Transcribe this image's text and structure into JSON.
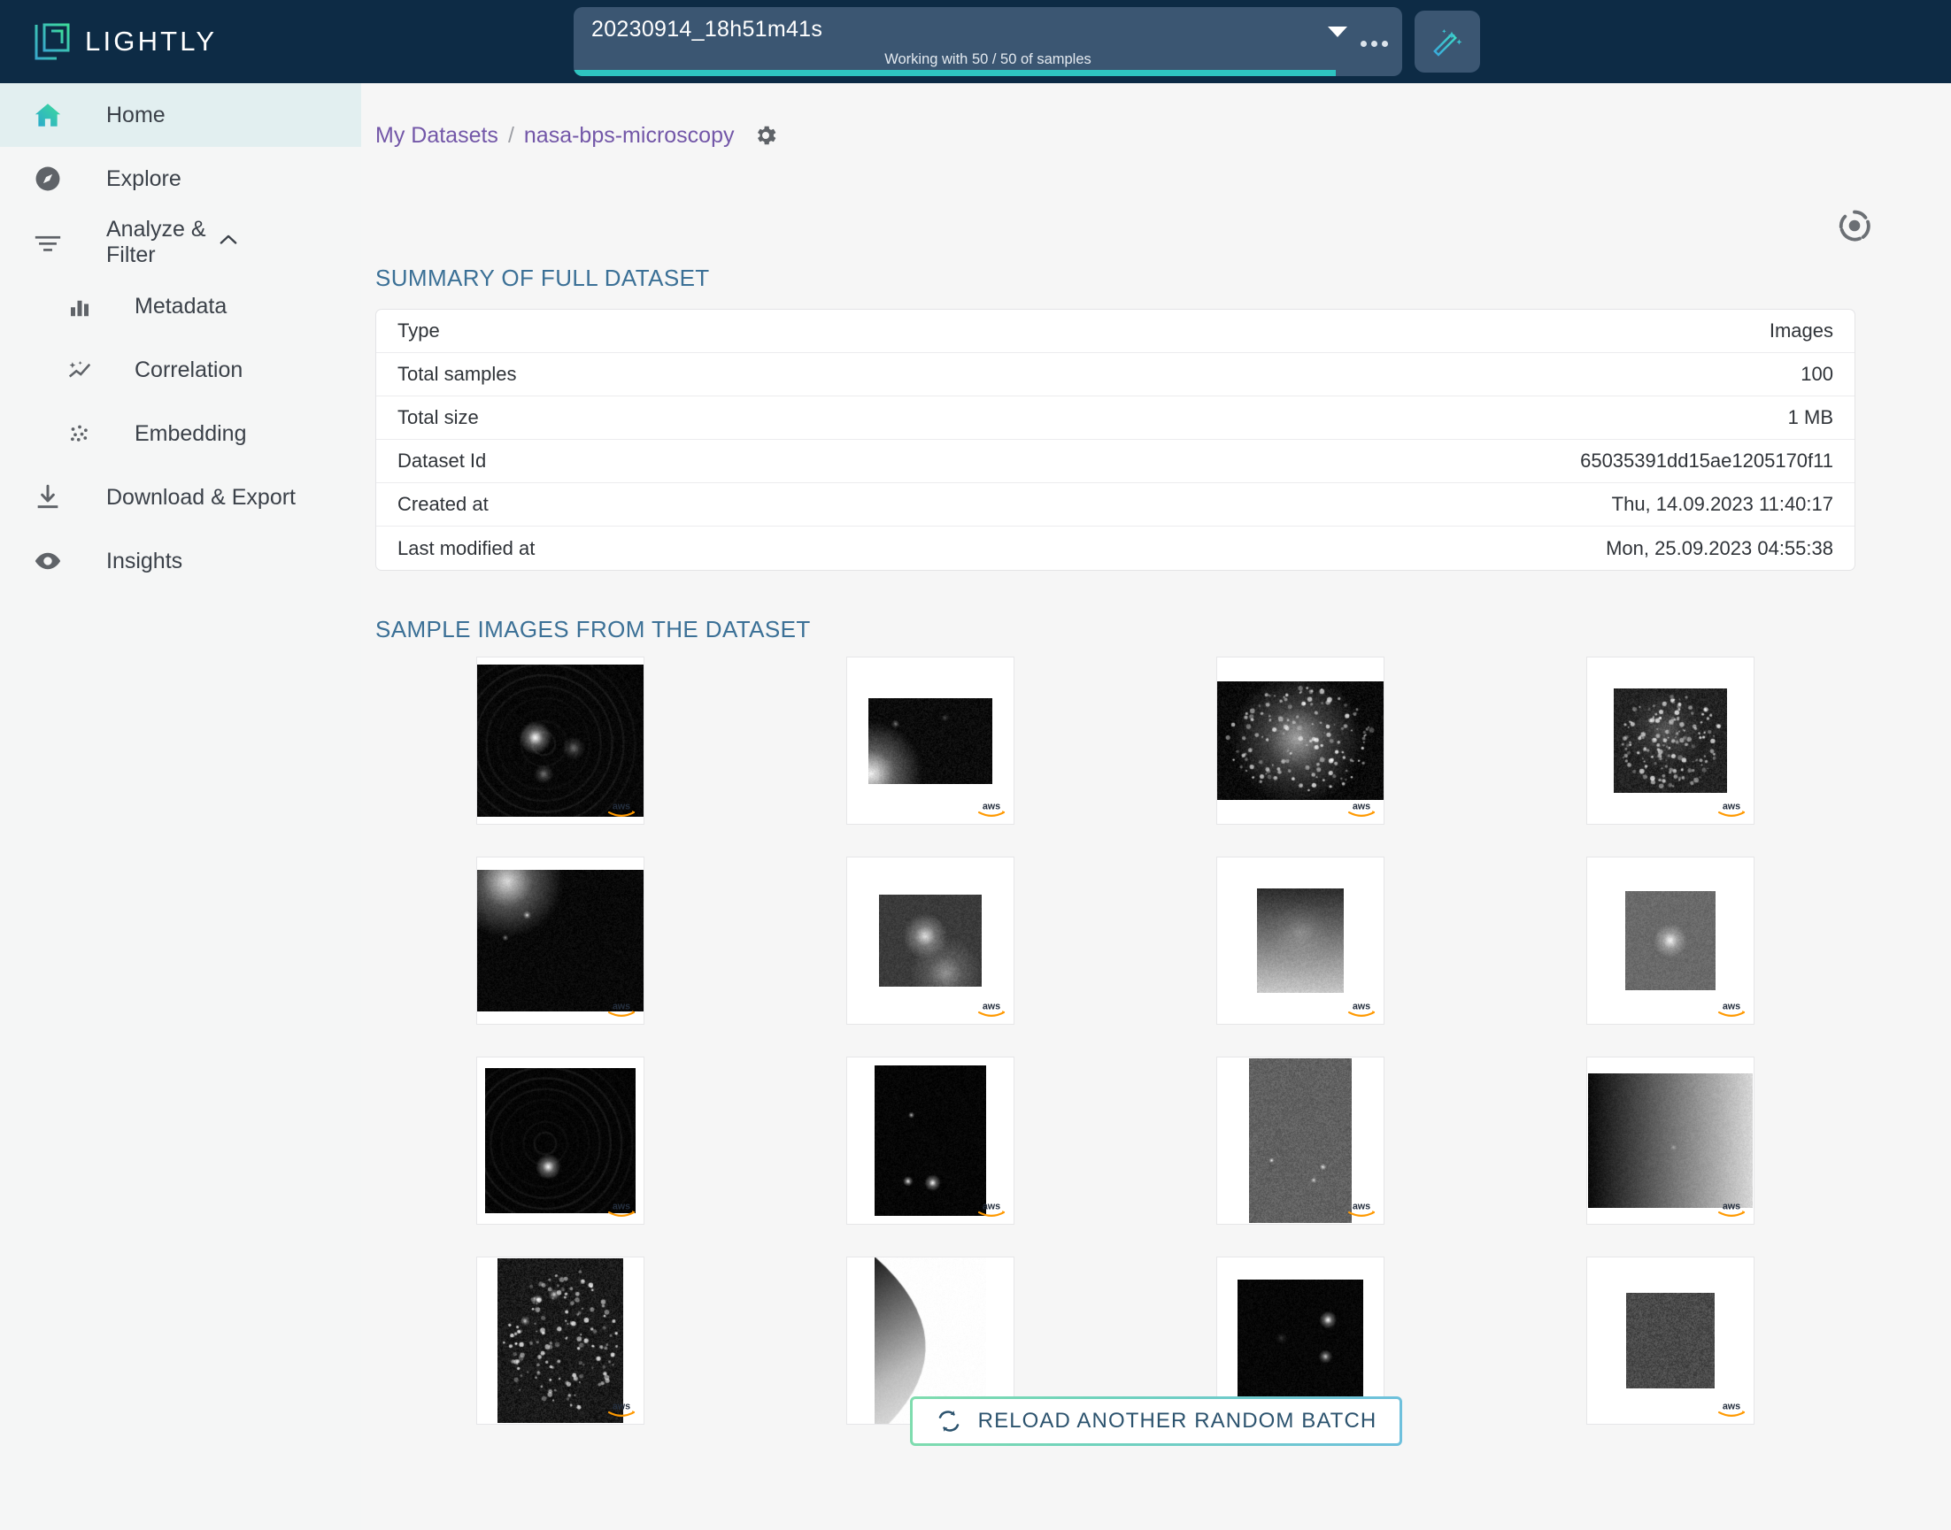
{
  "app": {
    "brand_name": "LIGHTLY",
    "brand_icon": "lightly-logo-icon",
    "header_bg": "#0d2b45",
    "accent_teal": "#2ec4c0"
  },
  "header": {
    "dataset_selector": {
      "value": "20230914_18h51m41s",
      "status_text": "Working with 50 / 50 of samples",
      "progress_percent": 92,
      "caret_icon": "chevron-down-icon",
      "more_icon": "more-options-icon"
    },
    "wand_button": {
      "icon": "magic-wand-icon",
      "label": ""
    }
  },
  "sidebar": {
    "items": [
      {
        "label": "Home",
        "icon": "home-icon",
        "active": true,
        "sub": false
      },
      {
        "label": "Explore",
        "icon": "compass-icon",
        "active": false,
        "sub": false
      },
      {
        "label": "Analyze & Filter",
        "icon": "filter-icon",
        "active": false,
        "sub": false,
        "expanded": true,
        "chevron": "chevron-up-icon"
      },
      {
        "label": "Metadata",
        "icon": "bar-chart-icon",
        "active": false,
        "sub": true
      },
      {
        "label": "Correlation",
        "icon": "sparkle-trend-icon",
        "active": false,
        "sub": true
      },
      {
        "label": "Embedding",
        "icon": "scatter-dots-icon",
        "active": false,
        "sub": true
      },
      {
        "label": "Download & Export",
        "icon": "download-icon",
        "active": false,
        "sub": false
      },
      {
        "label": "Insights",
        "icon": "eye-icon",
        "active": false,
        "sub": false
      }
    ]
  },
  "breadcrumb": {
    "root": "My Datasets",
    "separator": "/",
    "current": "nasa-bps-microscopy",
    "settings_icon": "gear-icon"
  },
  "toolbar": {
    "aperture_icon": "aperture-icon"
  },
  "main": {
    "summary_heading": "SUMMARY OF FULL DATASET",
    "summary_rows": [
      {
        "key": "Type",
        "value": "Images"
      },
      {
        "key": "Total samples",
        "value": "100"
      },
      {
        "key": "Total size",
        "value": "1 MB"
      },
      {
        "key": "Dataset Id",
        "value": "65035391dd15ae1205170f11"
      },
      {
        "key": "Created at",
        "value": "Thu, 14.09.2023 11:40:17"
      },
      {
        "key": "Last modified at",
        "value": "Mon, 25.09.2023 04:55:38"
      }
    ],
    "images_heading": "SAMPLE IMAGES FROM THE DATASET",
    "watermark_label": "aws",
    "thumbnails": [
      {
        "id": "sample-1",
        "w": 188,
        "h": 172,
        "style": "rings-bright-spot"
      },
      {
        "id": "sample-2",
        "w": 140,
        "h": 97,
        "style": "dark-speckles-left-glow"
      },
      {
        "id": "sample-3",
        "w": 188,
        "h": 134,
        "style": "bright-cell-cluster"
      },
      {
        "id": "sample-4",
        "w": 128,
        "h": 118,
        "style": "grey-speckle-field"
      },
      {
        "id": "sample-5",
        "w": 188,
        "h": 160,
        "style": "dark-corner-glow"
      },
      {
        "id": "sample-6",
        "w": 116,
        "h": 104,
        "style": "bright-blob-center"
      },
      {
        "id": "sample-7",
        "w": 98,
        "h": 118,
        "style": "vertical-grey-gradient"
      },
      {
        "id": "sample-8",
        "w": 102,
        "h": 112,
        "style": "bright-vertical-streak"
      },
      {
        "id": "sample-9",
        "w": 170,
        "h": 164,
        "style": "concentric-bright-core"
      },
      {
        "id": "sample-10",
        "w": 126,
        "h": 170,
        "style": "three-bright-dots"
      },
      {
        "id": "sample-11",
        "w": 116,
        "h": 186,
        "style": "grainy-grey-dots"
      },
      {
        "id": "sample-12",
        "w": 186,
        "h": 152,
        "style": "left-dark-right-light"
      },
      {
        "id": "sample-13",
        "w": 142,
        "h": 186,
        "style": "dark-starfield"
      },
      {
        "id": "sample-14",
        "w": 126,
        "h": 190,
        "style": "curved-white-edge"
      },
      {
        "id": "sample-15",
        "w": 142,
        "h": 138,
        "style": "dark-bright-clusters"
      },
      {
        "id": "sample-16",
        "w": 100,
        "h": 108,
        "style": "grey-noise-square"
      }
    ],
    "reload_button": {
      "label": "RELOAD ANOTHER RANDOM BATCH",
      "icon": "refresh-icon"
    }
  }
}
